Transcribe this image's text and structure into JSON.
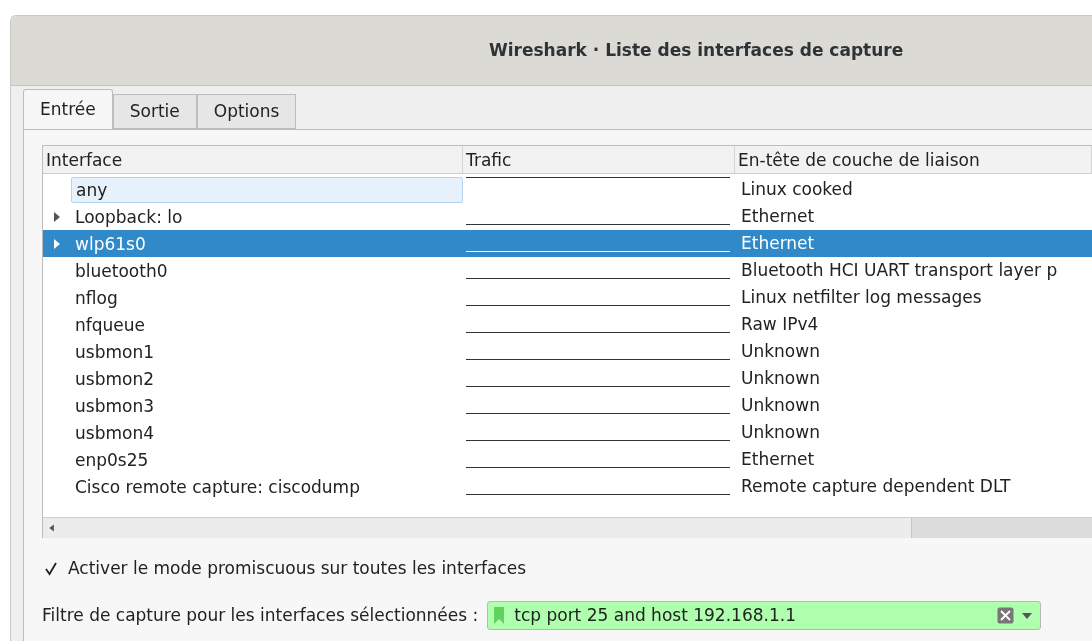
{
  "window": {
    "title": "Wireshark · Liste des interfaces de capture"
  },
  "tabs": [
    {
      "label": "Entrée",
      "selected": true
    },
    {
      "label": "Sortie",
      "selected": false
    },
    {
      "label": "Options",
      "selected": false
    }
  ],
  "table": {
    "columns": [
      "Interface",
      "Trafic",
      "En-tête de couche de liaison"
    ],
    "rows": [
      {
        "interface": "any",
        "link_header": "Linux cooked",
        "expandable": false,
        "selected": false,
        "focused": true
      },
      {
        "interface": "Loopback: lo",
        "link_header": "Ethernet",
        "expandable": true,
        "selected": false,
        "focused": false
      },
      {
        "interface": "wlp61s0",
        "link_header": "Ethernet",
        "expandable": true,
        "selected": true,
        "focused": false
      },
      {
        "interface": "bluetooth0",
        "link_header": "Bluetooth HCI UART transport layer p",
        "expandable": false,
        "selected": false,
        "focused": false
      },
      {
        "interface": "nflog",
        "link_header": "Linux netfilter log messages",
        "expandable": false,
        "selected": false,
        "focused": false
      },
      {
        "interface": "nfqueue",
        "link_header": "Raw IPv4",
        "expandable": false,
        "selected": false,
        "focused": false
      },
      {
        "interface": "usbmon1",
        "link_header": "Unknown",
        "expandable": false,
        "selected": false,
        "focused": false
      },
      {
        "interface": "usbmon2",
        "link_header": "Unknown",
        "expandable": false,
        "selected": false,
        "focused": false
      },
      {
        "interface": "usbmon3",
        "link_header": "Unknown",
        "expandable": false,
        "selected": false,
        "focused": false
      },
      {
        "interface": "usbmon4",
        "link_header": "Unknown",
        "expandable": false,
        "selected": false,
        "focused": false
      },
      {
        "interface": "enp0s25",
        "link_header": "Ethernet",
        "expandable": false,
        "selected": false,
        "focused": false
      },
      {
        "interface": "Cisco remote capture: ciscodump",
        "link_header": "Remote capture dependent DLT",
        "expandable": false,
        "selected": false,
        "focused": false
      }
    ]
  },
  "promiscuous": {
    "label": "Activer le mode promiscuous sur toutes les interfaces",
    "checked": true
  },
  "capture_filter": {
    "label": "Filtre de capture pour les interfaces sélectionnées :",
    "value": "tcp port 25 and host 192.168.1.1",
    "valid": true
  }
}
